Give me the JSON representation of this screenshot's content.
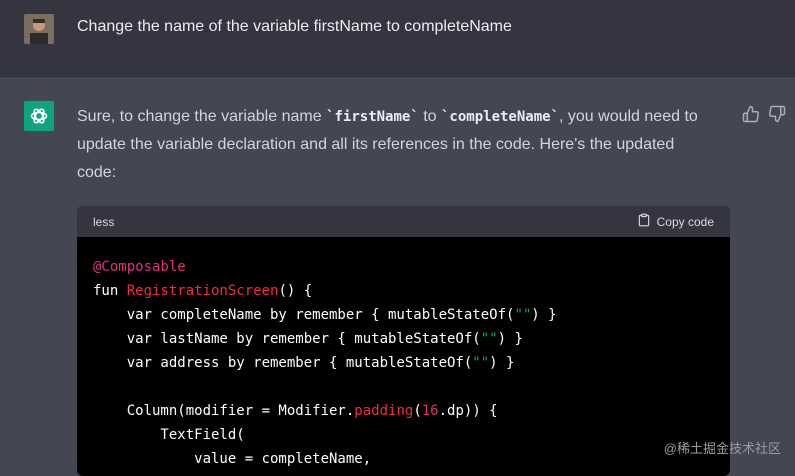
{
  "user_message": {
    "avatar_icon": "user-avatar",
    "text": "Change the name of the variable firstName to completeName"
  },
  "assistant_message": {
    "logo_icon": "openai-logo-icon",
    "reply_part1": "Sure, to change the variable name ",
    "reply_code1": "`firstName`",
    "reply_part2": " to ",
    "reply_code2": "`completeName`",
    "reply_part3": ", you would need to update the variable declaration and all its references in the code. Here's the updated code:",
    "feedback": {
      "thumbs_up_icon": "thumbs-up-icon",
      "thumbs_down_icon": "thumbs-down-icon"
    }
  },
  "code_block": {
    "language": "less",
    "copy_label": "Copy code",
    "lines": [
      [
        {
          "t": "@Composable",
          "c": "kw-ann"
        }
      ],
      [
        {
          "t": "fun "
        },
        {
          "t": "RegistrationScreen",
          "c": "fn"
        },
        {
          "t": "() {"
        }
      ],
      [
        {
          "t": "    var completeName by remember { mutableStateOf("
        },
        {
          "t": "\"\"",
          "c": "str"
        },
        {
          "t": ") }"
        }
      ],
      [
        {
          "t": "    var lastName by remember { mutableStateOf("
        },
        {
          "t": "\"\"",
          "c": "str"
        },
        {
          "t": ") }"
        }
      ],
      [
        {
          "t": "    var address by remember { mutableStateOf("
        },
        {
          "t": "\"\"",
          "c": "str"
        },
        {
          "t": ") }"
        }
      ],
      [
        {
          "t": ""
        }
      ],
      [
        {
          "t": "    Column(modifier = Modifier."
        },
        {
          "t": "padding",
          "c": "fn"
        },
        {
          "t": "("
        },
        {
          "t": "16",
          "c": "num"
        },
        {
          "t": ".dp)) {"
        }
      ],
      [
        {
          "t": "        TextField("
        }
      ],
      [
        {
          "t": "            value = completeName,"
        }
      ]
    ]
  },
  "watermark": "@稀土掘金技术社区"
}
